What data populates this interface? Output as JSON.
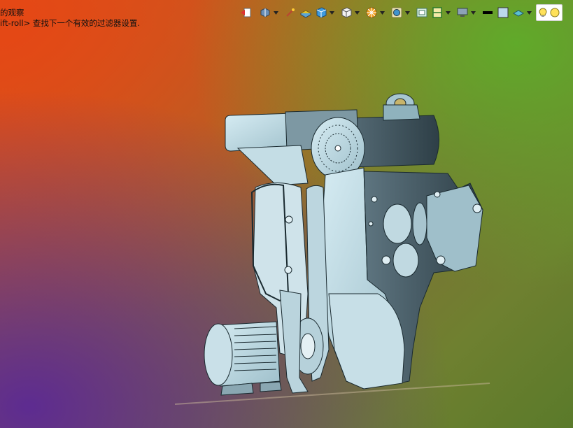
{
  "hints": {
    "line1": "的观察",
    "line2": "ift-roll> 查找下一个有效的过滤器设置."
  },
  "toolbar": {
    "items": [
      {
        "icon": "previous-view-icon",
        "dropdown": false
      },
      {
        "icon": "view-orientation-icon",
        "dropdown": true
      },
      {
        "icon": "zoom-area-icon",
        "dropdown": false
      },
      {
        "icon": "section-view-icon",
        "dropdown": false
      },
      {
        "icon": "view-selector-cube-icon",
        "dropdown": true
      },
      {
        "icon": "display-style-icon",
        "dropdown": true
      },
      {
        "icon": "hide-show-items-icon",
        "dropdown": true
      },
      {
        "icon": "edit-appearance-icon",
        "dropdown": true
      },
      {
        "icon": "apply-scene-icon",
        "dropdown": false
      },
      {
        "icon": "view-settings-icon",
        "dropdown": true
      },
      {
        "icon": "monitor-display-icon",
        "dropdown": true
      },
      {
        "icon": "line-color-icon",
        "dropdown": false
      },
      {
        "icon": "background-color-icon",
        "dropdown": false
      },
      {
        "icon": "scene-icon",
        "dropdown": true
      },
      {
        "icon": "lights-icon",
        "dropdown": false
      }
    ]
  },
  "colors": {
    "part_fill": "#b9d6df",
    "part_edge": "#1a2a30",
    "part_dark": "#3f5560",
    "part_mid": "#8fb2bd"
  },
  "viewport": {
    "model": "belt-grinder-assembly"
  }
}
